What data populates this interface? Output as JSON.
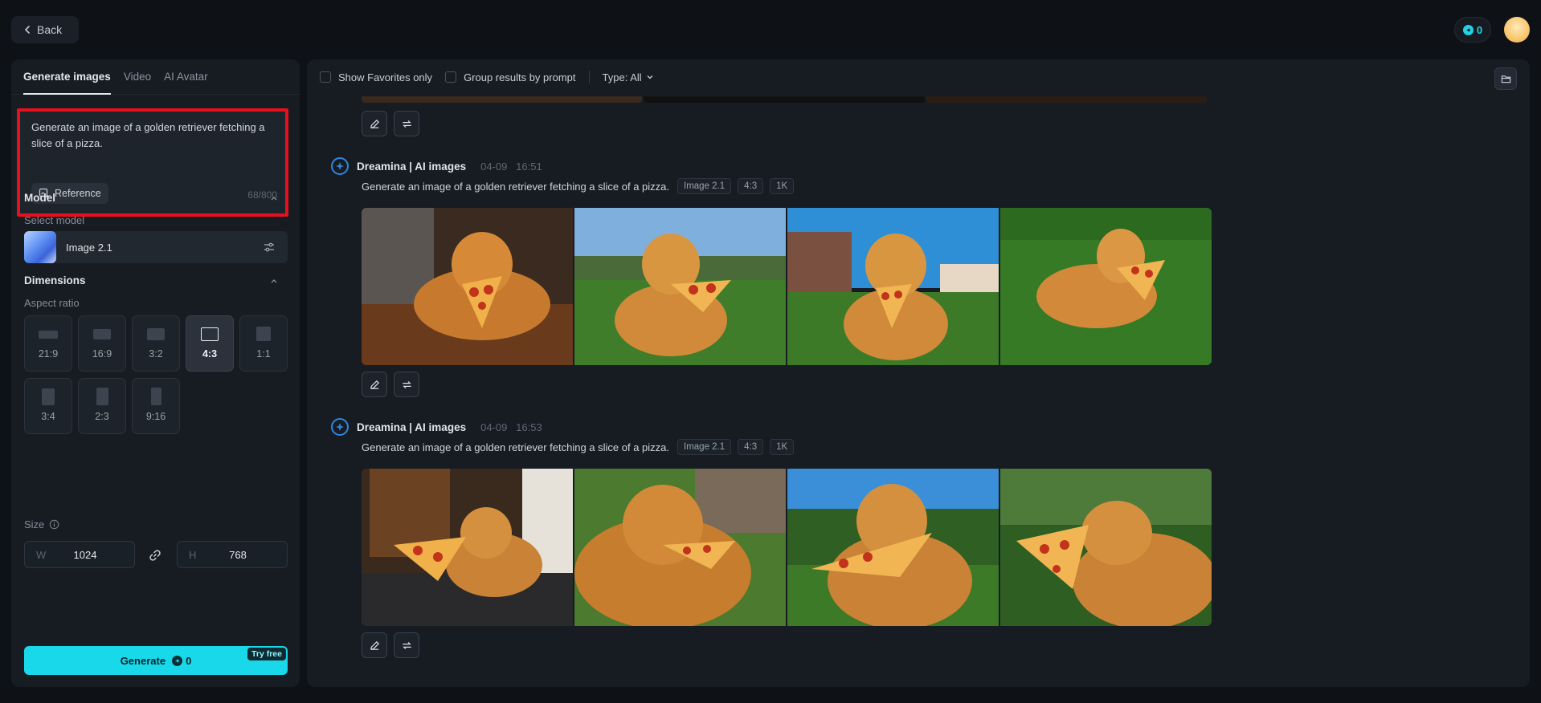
{
  "header": {
    "back_label": "Back",
    "credits": "0"
  },
  "left": {
    "tabs": [
      "Generate images",
      "Video",
      "AI Avatar"
    ],
    "prompt": "Generate an image of a golden retriever fetching a slice of a pizza.",
    "reference_label": "Reference",
    "char_count": "68/800",
    "model_section": "Model",
    "select_model_label": "Select model",
    "model_name": "Image 2.1",
    "dimensions_section": "Dimensions",
    "aspect_ratio_label": "Aspect ratio",
    "ratios": [
      "21:9",
      "16:9",
      "3:2",
      "4:3",
      "1:1",
      "3:4",
      "2:3",
      "9:16"
    ],
    "selected_ratio": "4:3",
    "size_label": "Size",
    "width_label": "W",
    "width_value": "1024",
    "height_label": "H",
    "height_value": "768",
    "generate_label": "Generate",
    "generate_cost": "0",
    "try_free": "Try free"
  },
  "right": {
    "filters": {
      "favorites": "Show Favorites only",
      "group": "Group results by prompt",
      "type": "Type: All"
    },
    "generations": [
      {
        "author": "Dreamina | AI images",
        "time": "04-09   16:51",
        "prompt": "Generate an image of a golden retriever fetching a slice of a pizza.",
        "tags": [
          "Image 2.1",
          "4:3",
          "1K"
        ]
      },
      {
        "author": "Dreamina | AI images",
        "time": "04-09   16:53",
        "prompt": "Generate an image of a golden retriever fetching a slice of a pizza.",
        "tags": [
          "Image 2.1",
          "4:3",
          "1K"
        ]
      }
    ]
  },
  "colors": {
    "accent": "#19d8e9",
    "highlight_border": "#e8101d",
    "background": "#0e1116",
    "panel": "#171c23"
  },
  "icons": [
    "chevron-left-icon",
    "credit-icon",
    "avatar",
    "reference-icon",
    "chevron-up-icon",
    "settings-sliders-icon",
    "info-icon",
    "link-icon",
    "folder-icon",
    "chevron-down-icon",
    "edit-icon",
    "regenerate-icon",
    "dreamina-logo-icon"
  ]
}
